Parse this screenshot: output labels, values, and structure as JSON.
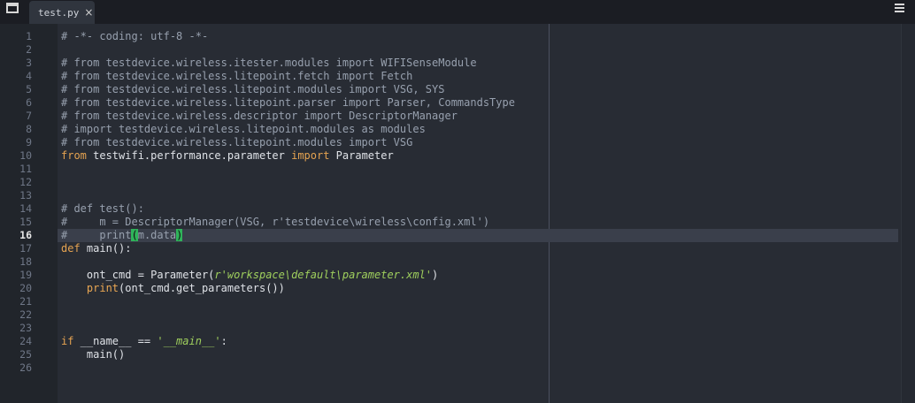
{
  "tab": {
    "title": "test.py",
    "close_glyph": "×"
  },
  "editor": {
    "active_line": "16",
    "lines": [
      {
        "n": "1",
        "t": "# -*- coding: utf-8 -*-"
      },
      {
        "n": "2",
        "t": ""
      },
      {
        "n": "3",
        "t": "# from testdevice.wireless.itester.modules import WIFISenseModule"
      },
      {
        "n": "4",
        "t": "# from testdevice.wireless.litepoint.fetch import Fetch"
      },
      {
        "n": "5",
        "t": "# from testdevice.wireless.litepoint.modules import VSG, SYS"
      },
      {
        "n": "6",
        "t": "# from testdevice.wireless.litepoint.parser import Parser, CommandsType"
      },
      {
        "n": "7",
        "t": "# from testdevice.wireless.descriptor import DescriptorManager"
      },
      {
        "n": "8",
        "t": "# import testdevice.wireless.litepoint.modules as modules"
      },
      {
        "n": "9",
        "t": "# from testdevice.wireless.litepoint.modules import VSG"
      },
      {
        "n": "10",
        "kw1": "from",
        "mod": " testwifi.performance.parameter ",
        "kw2": "import",
        "name": " Parameter"
      },
      {
        "n": "11",
        "t": ""
      },
      {
        "n": "12",
        "t": ""
      },
      {
        "n": "13",
        "t": ""
      },
      {
        "n": "14",
        "t": "# def test():"
      },
      {
        "n": "15",
        "t": "#     m = DescriptorManager(VSG, r'testdevice\\wireless\\config.xml')"
      },
      {
        "n": "16",
        "pre": "#     print",
        "open": "(",
        "mid": "m.data",
        "close": ")"
      },
      {
        "n": "17",
        "kw": "def",
        "name": " main",
        "rest": "():"
      },
      {
        "n": "18",
        "t": ""
      },
      {
        "n": "19",
        "pre": "    ont_cmd = Parameter(",
        "str": "r'workspace\\default\\parameter.xml'",
        "post": ")"
      },
      {
        "n": "20",
        "indent": "    ",
        "fn": "print",
        "rest": "(ont_cmd.get_parameters())"
      },
      {
        "n": "21",
        "t": ""
      },
      {
        "n": "22",
        "t": ""
      },
      {
        "n": "23",
        "t": ""
      },
      {
        "n": "24",
        "kw": "if",
        "pre": " __name__ == ",
        "str": "'__main__'",
        "post": ":"
      },
      {
        "n": "25",
        "t": "    main()"
      },
      {
        "n": "26",
        "t": ""
      }
    ]
  },
  "icons": {
    "left": "sidebar-toggle-icon",
    "right": "hamburger-menu-icon"
  }
}
